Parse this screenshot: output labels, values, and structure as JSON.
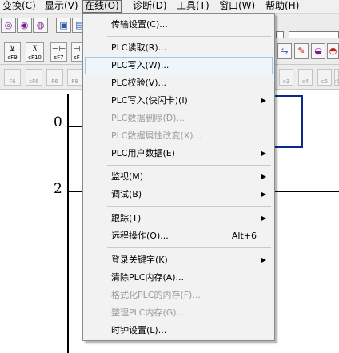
{
  "menubar": {
    "items": [
      {
        "label": "变换(C)"
      },
      {
        "label": "显示(V)"
      },
      {
        "label": "在线(O)"
      },
      {
        "label": "诊断(D)"
      },
      {
        "label": "工具(T)"
      },
      {
        "label": "窗口(W)"
      },
      {
        "label": "帮助(H)"
      }
    ]
  },
  "toolbar2": {
    "buttons": [
      {
        "label": "cF9",
        "icon": "⊻"
      },
      {
        "label": "cF10",
        "icon": "⊼"
      },
      {
        "label": "sF7",
        "icon": "⊣⊢"
      },
      {
        "label": "sF",
        "icon": "⊣"
      }
    ]
  },
  "toolbar3": {
    "left_buttons": [
      {
        "label": "F6"
      },
      {
        "label": "sF6"
      },
      {
        "label": "F6"
      },
      {
        "label": "F8"
      }
    ],
    "right_buttons": [
      {
        "label": "c3"
      },
      {
        "label": "c4"
      },
      {
        "label": "c5"
      },
      {
        "label": "c5"
      }
    ]
  },
  "ladder": {
    "steps": [
      "0",
      "2"
    ]
  },
  "dropdown": {
    "items": [
      {
        "label": "传输设置(C)...",
        "enabled": true
      },
      {
        "label": "PLC读取(R)...",
        "enabled": true
      },
      {
        "label": "PLC写入(W)...",
        "enabled": true,
        "highlighted": true
      },
      {
        "label": "PLC校验(V)...",
        "enabled": true
      },
      {
        "label": "PLC写入(快闪卡)(I)",
        "enabled": true,
        "submenu": true
      },
      {
        "label": "PLC数据删除(D)...",
        "enabled": false
      },
      {
        "label": "PLC数据属性改变(X)...",
        "enabled": false
      },
      {
        "label": "PLC用户数据(E)",
        "enabled": true,
        "submenu": true
      },
      {
        "label": "监视(M)",
        "enabled": true,
        "submenu": true
      },
      {
        "label": "调试(B)",
        "enabled": true,
        "submenu": true
      },
      {
        "label": "跟踪(T)",
        "enabled": true,
        "submenu": true
      },
      {
        "label": "远程操作(O)...",
        "enabled": true,
        "shortcut": "Alt+6"
      },
      {
        "label": "登录关键字(K)",
        "enabled": true,
        "submenu": true
      },
      {
        "label": "清除PLC内存(A)...",
        "enabled": true
      },
      {
        "label": "格式化PLC的内存(F)...",
        "enabled": false
      },
      {
        "label": "整理PLC内存(G)...",
        "enabled": false
      },
      {
        "label": "时钟设置(L)...",
        "enabled": true
      }
    ]
  },
  "colors": {
    "highlight_bg": "#eef6fc",
    "highlight_border": "#9ec6e8",
    "disabled_text": "#9b9b9b",
    "ladder_blue": "#0a2a8a"
  }
}
